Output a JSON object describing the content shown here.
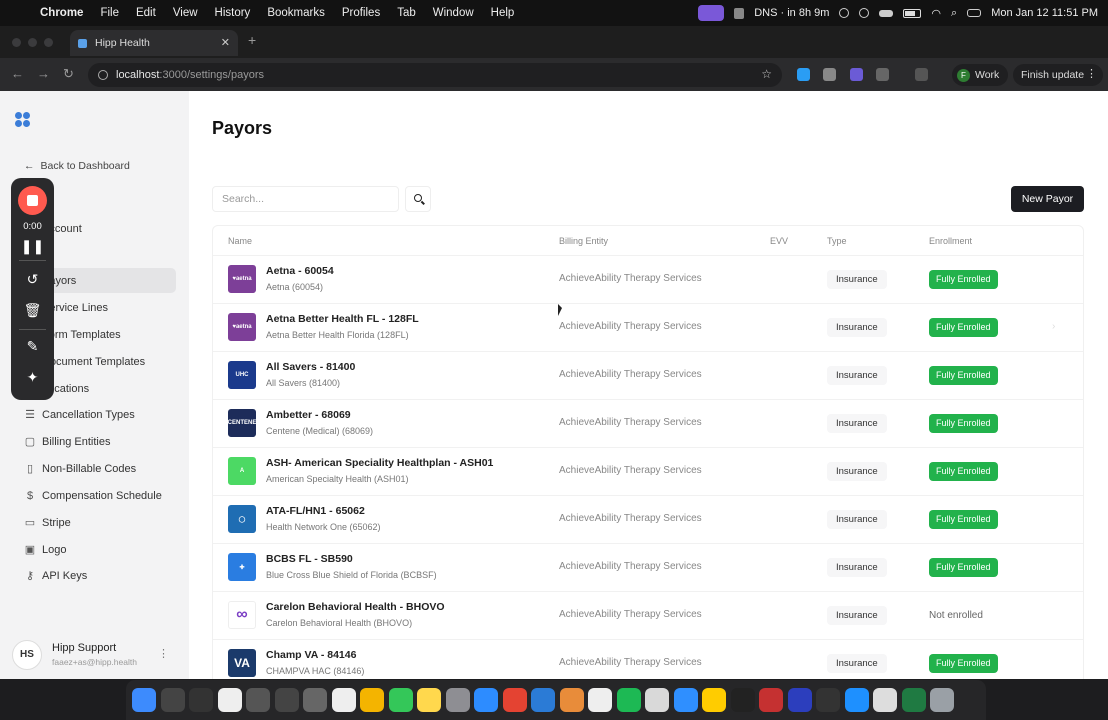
{
  "menubar": {
    "app_name": "Chrome",
    "items": [
      "File",
      "Edit",
      "View",
      "History",
      "Bookmarks",
      "Profiles",
      "Tab",
      "Window",
      "Help"
    ],
    "dns_status": "DNS · in 8h 9m",
    "datetime": "Mon Jan 12  11:51 PM"
  },
  "browser": {
    "tab_title": "Hipp Health",
    "url_host": "localhost",
    "url_path": ":3000/settings/payors",
    "profile_initial": "F",
    "profile_label": "Work",
    "update_label": "Finish update"
  },
  "sidebar": {
    "back_label": "Back to Dashboard",
    "items": [
      {
        "label": "Account",
        "icon": "user-icon"
      },
      {
        "label": "Payors",
        "icon": "building-icon",
        "active": true
      },
      {
        "label": "Service Lines",
        "icon": "layers-icon"
      },
      {
        "label": "Form Templates",
        "icon": "file-icon"
      },
      {
        "label": "Document Templates",
        "icon": "document-icon"
      },
      {
        "label": "Locations",
        "icon": "pin-icon"
      },
      {
        "label": "Cancellation Types",
        "icon": "list-icon"
      },
      {
        "label": "Billing Entities",
        "icon": "clipboard-icon"
      },
      {
        "label": "Non-Billable Codes",
        "icon": "file-x-icon"
      },
      {
        "label": "Compensation Schedule",
        "icon": "dollar-icon"
      },
      {
        "label": "Stripe",
        "icon": "card-icon"
      },
      {
        "label": "Logo",
        "icon": "image-icon"
      },
      {
        "label": "API Keys",
        "icon": "key-icon"
      }
    ],
    "user": {
      "initials": "HS",
      "name": "Hipp Support",
      "email": "faaez+as@hipp.health"
    }
  },
  "recorder": {
    "time": "0:00"
  },
  "main": {
    "title": "Payors",
    "search_placeholder": "Search...",
    "new_button": "New Payor",
    "columns": {
      "name": "Name",
      "billing": "Billing Entity",
      "evv": "EVV",
      "type": "Type",
      "enrollment": "Enrollment"
    },
    "rows": [
      {
        "name": "Aetna - 60054",
        "sub": "Aetna (60054)",
        "billing": "AchieveAbility Therapy Services",
        "type": "Insurance",
        "enrollment": "Fully Enrolled",
        "logo_text": "♥aetna",
        "logo_color": "#7d3f98"
      },
      {
        "name": "Aetna Better Health FL - 128FL",
        "sub": "Aetna Better Health Florida (128FL)",
        "billing": "AchieveAbility Therapy Services",
        "type": "Insurance",
        "enrollment": "Fully Enrolled",
        "logo_text": "♥aetna",
        "logo_color": "#7d3f98"
      },
      {
        "name": "All Savers - 81400",
        "sub": "All Savers (81400)",
        "billing": "AchieveAbility Therapy Services",
        "type": "Insurance",
        "enrollment": "Fully Enrolled",
        "logo_text": "UHC",
        "logo_color": "#1b3a8c"
      },
      {
        "name": "Ambetter - 68069",
        "sub": "Centene (Medical) (68069)",
        "billing": "AchieveAbility Therapy Services",
        "type": "Insurance",
        "enrollment": "Fully Enrolled",
        "logo_text": "CENTENE",
        "logo_color": "#1d2c5a"
      },
      {
        "name": "ASH- American Speciality Healthplan - ASH01",
        "sub": "American Specialty Health (ASH01)",
        "billing": "AchieveAbility Therapy Services",
        "type": "Insurance",
        "enrollment": "Fully Enrolled",
        "logo_text": "A",
        "logo_color": "#4cd964"
      },
      {
        "name": "ATA-FL/HN1 - 65062",
        "sub": "Health Network One (65062)",
        "billing": "AchieveAbility Therapy Services",
        "type": "Insurance",
        "enrollment": "Fully Enrolled",
        "logo_text": "◯",
        "logo_color": "#1f6db3"
      },
      {
        "name": "BCBS FL - SB590",
        "sub": "Blue Cross Blue Shield of Florida (BCBSF)",
        "billing": "AchieveAbility Therapy Services",
        "type": "Insurance",
        "enrollment": "Fully Enrolled",
        "logo_text": "✚",
        "logo_color": "#2a7de1"
      },
      {
        "name": "Carelon Behavioral Health - BHOVO",
        "sub": "Carelon Behavioral Health (BHOVO)",
        "billing": "AchieveAbility Therapy Services",
        "type": "Insurance",
        "enrollment": "Not enrolled",
        "logo_text": "∞",
        "logo_color": "#ffffff"
      },
      {
        "name": "Champ VA - 84146",
        "sub": "CHAMPVA HAC (84146)",
        "billing": "AchieveAbility Therapy Services",
        "type": "Insurance",
        "enrollment": "Fully Enrolled",
        "logo_text": "VA",
        "logo_color": "#1b3a6b"
      }
    ]
  },
  "dock": {
    "apps": [
      {
        "icon": "finder-icon",
        "color": "#3d8bfd"
      },
      {
        "icon": "cursor-app-icon",
        "color": "#444"
      },
      {
        "icon": "notes-dark-icon",
        "color": "#333"
      },
      {
        "icon": "notion-icon",
        "color": "#eeeeee"
      },
      {
        "icon": "calendar-icon",
        "color": "#555"
      },
      {
        "icon": "send-icon",
        "color": "#444"
      },
      {
        "icon": "arc-icon",
        "color": "#666"
      },
      {
        "icon": "chatgpt-icon",
        "color": "#eeeeee"
      },
      {
        "icon": "chrome-icon",
        "color": "#f4b400"
      },
      {
        "icon": "messages-icon",
        "color": "#34c759"
      },
      {
        "icon": "notes-icon",
        "color": "#ffd84d"
      },
      {
        "icon": "settings-icon",
        "color": "#8e8e93"
      },
      {
        "icon": "zoom-icon",
        "color": "#2d8cff"
      },
      {
        "icon": "todoist-icon",
        "color": "#e44332"
      },
      {
        "icon": "vscode-icon",
        "color": "#2b7bd6"
      },
      {
        "icon": "toolbox-icon",
        "color": "#e88c3a"
      },
      {
        "icon": "slack-icon",
        "color": "#eeeeee"
      },
      {
        "icon": "spotify-icon",
        "color": "#1db954"
      },
      {
        "icon": "claude-icon",
        "color": "#d9d9d9"
      },
      {
        "icon": "safari-icon",
        "color": "#2f8fff"
      },
      {
        "icon": "tableplus-icon",
        "color": "#ffcc00"
      },
      {
        "icon": "terminal-icon",
        "color": "#222"
      },
      {
        "icon": "screenshot-icon",
        "color": "#c53131"
      },
      {
        "icon": "remote-icon",
        "color": "#2c3ebd"
      },
      {
        "icon": "activity-icon",
        "color": "#333"
      },
      {
        "icon": "appstore-icon",
        "color": "#1e90ff"
      },
      {
        "icon": "textedit-icon",
        "color": "#ddd"
      },
      {
        "icon": "excel-icon",
        "color": "#1f7a42"
      },
      {
        "icon": "trash-icon",
        "color": "#9aa0a6"
      }
    ]
  }
}
